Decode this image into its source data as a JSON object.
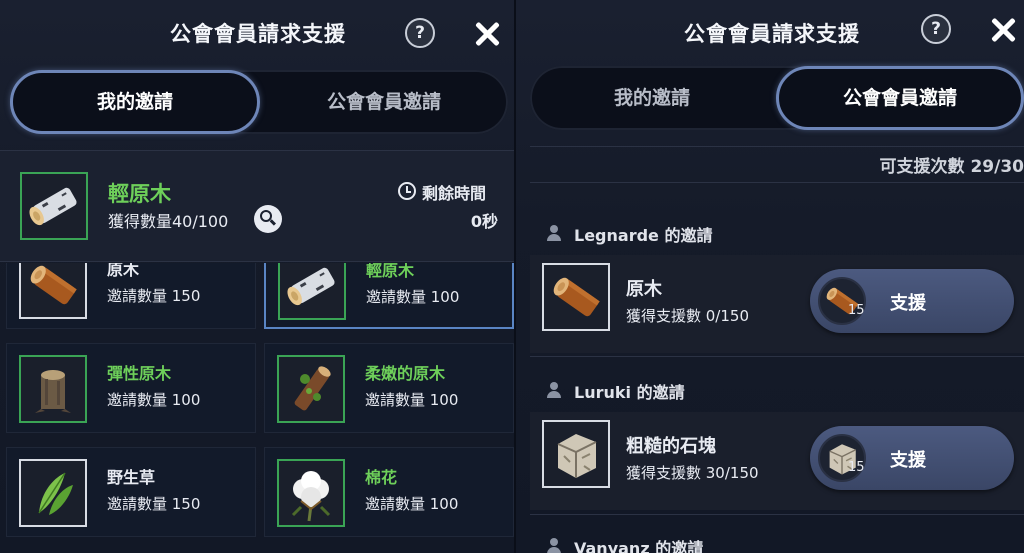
{
  "left": {
    "title": "公會會員請求支援",
    "help": "?",
    "tabs": [
      "我的邀請",
      "公會會員邀請"
    ],
    "active_tab": 0,
    "header": {
      "item_name": "輕原木",
      "item_icon": "birch-log-icon",
      "obtained": "獲得數量40/100",
      "remaining_label": "剩餘時間",
      "remaining_value": "0秒"
    },
    "items": [
      {
        "name": "原木",
        "count": "邀請數量 150",
        "icon": "log-icon",
        "green": false,
        "selected": false
      },
      {
        "name": "輕原木",
        "count": "邀請數量 100",
        "icon": "birch-log-icon",
        "green": true,
        "selected": true
      },
      {
        "name": "彈性原木",
        "count": "邀請數量 100",
        "icon": "stump-icon",
        "green": true,
        "selected": false
      },
      {
        "name": "柔嫩的原木",
        "count": "邀請數量 100",
        "icon": "mossy-log-icon",
        "green": true,
        "selected": false
      },
      {
        "name": "野生草",
        "count": "邀請數量 150",
        "icon": "grass-icon",
        "green": false,
        "selected": false
      },
      {
        "name": "棉花",
        "count": "邀請數量 100",
        "icon": "cotton-icon",
        "green": true,
        "selected": false
      }
    ]
  },
  "right": {
    "title": "公會會員請求支援",
    "help": "?",
    "tabs": [
      "我的邀請",
      "公會會員邀請"
    ],
    "active_tab": 1,
    "support_count": "可支援次數 29/30",
    "requests": [
      {
        "user": "Legnarde 的邀請",
        "item": "原木",
        "progress": "獲得支援數 0/150",
        "icon": "log-icon",
        "qty": "15",
        "button": "支援"
      },
      {
        "user": "Luruki 的邀請",
        "item": "粗糙的石塊",
        "progress": "獲得支援數 30/150",
        "icon": "stone-icon",
        "qty": "15",
        "button": "支援"
      },
      {
        "user": "Vanyanz 的邀請"
      }
    ]
  },
  "colors": {
    "accent_green": "#6ed05a",
    "tab_active_border": "#6e86b8",
    "selected_border": "#5a85c4"
  }
}
